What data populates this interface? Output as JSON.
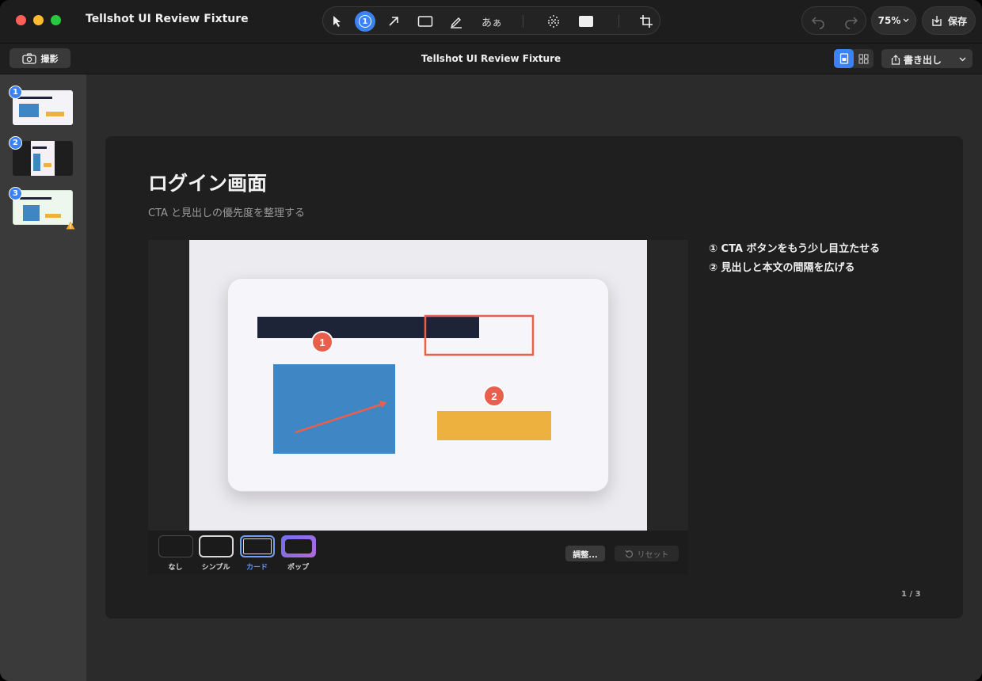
{
  "window": {
    "app_title": "Tellshot UI Review Fixture"
  },
  "toolbar": {
    "tools": [
      {
        "name": "select",
        "icon": "cursor-arrow-icon"
      },
      {
        "name": "step",
        "icon": "numbered-step-icon",
        "label": "1",
        "active": true
      },
      {
        "name": "arrow",
        "icon": "arrow-icon"
      },
      {
        "name": "rectangle",
        "icon": "rectangle-icon"
      },
      {
        "name": "pen",
        "icon": "pen-icon"
      },
      {
        "name": "text",
        "label": "あぁ"
      },
      {
        "name": "blur",
        "icon": "mosaic-icon"
      },
      {
        "name": "mask",
        "icon": "mask-rect-icon"
      },
      {
        "name": "crop",
        "icon": "crop-icon"
      }
    ],
    "zoom": "75%",
    "save_label": "保存"
  },
  "subbar": {
    "capture_label": "撮影",
    "document_title": "Tellshot UI Review Fixture",
    "export_label": "書き出し"
  },
  "sidebar": {
    "thumbnails": [
      {
        "badge": "1"
      },
      {
        "badge": "2"
      },
      {
        "badge": "3",
        "warning": true
      }
    ]
  },
  "slide": {
    "title": "ログイン画面",
    "subtitle": "CTA と見出しの優先度を整理する",
    "notes": [
      "① CTA ボタンをもう少し目立たせる",
      "② 見出しと本文の間隔を広げる"
    ],
    "markers": [
      "1",
      "2"
    ],
    "colors": {
      "accent": "#3b82f6",
      "annotation": "#e8604c",
      "heading_bar": "#1e2438",
      "image_block": "#3f86c4",
      "cta_block": "#edb140"
    }
  },
  "frame_styles": {
    "options": [
      {
        "label": "なし"
      },
      {
        "label": "シンプル"
      },
      {
        "label": "カード",
        "selected": true
      },
      {
        "label": "ポップ"
      }
    ],
    "adjust_label": "調整...",
    "reset_label": "リセット"
  },
  "pagination": {
    "indicator": "1 / 3"
  }
}
